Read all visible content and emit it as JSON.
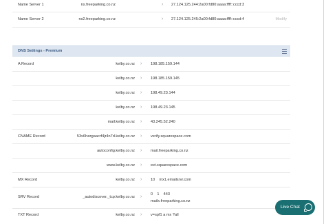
{
  "name_servers": [
    {
      "label": "Name Server 1",
      "host": "ns.freeparking.co.nz",
      "value": "27.124.125.244:2a00:fd80:aaaa:ffff::cccd:3",
      "action": ""
    },
    {
      "label": "Name Server 2",
      "host": "ns2.freeparking.co.nz",
      "value": "27.124.125.245:2a00:fd80:aaaa:ffff::cccd:4",
      "action": "Modify"
    }
  ],
  "dns_section": {
    "title": "DNS Settings - Premium",
    "menu_icon": "hamburger-menu-icon"
  },
  "records": [
    {
      "label": "A Record",
      "host": "kelby.co.nz",
      "value": "198.185.159.144",
      "value2": ""
    },
    {
      "label": "",
      "host": "kelby.co.nz",
      "value": "198.185.159.145",
      "value2": ""
    },
    {
      "label": "",
      "host": "kelby.co.nz",
      "value": "198.49.23.144",
      "value2": ""
    },
    {
      "label": "",
      "host": "kelby.co.nz",
      "value": "198.49.23.145",
      "value2": ""
    },
    {
      "label": "",
      "host": "mail.kelby.co.nz",
      "value": "43.245.52.240",
      "value2": ""
    },
    {
      "label": "CNAME Record",
      "host": "53x6hzzgaacrf4jr4n7d.kelby.co.nz",
      "value": "verify.squarespace.com",
      "value2": ""
    },
    {
      "label": "",
      "host": "autoconfig.kelby.co.nz",
      "value": "mail.freeparking.co.nz",
      "value2": ""
    },
    {
      "label": "",
      "host": "www.kelby.co.nz",
      "value": "ext.squarespace.com",
      "value2": ""
    },
    {
      "label": "MX Record",
      "host": "kelby.co.nz",
      "value": "10    mx1.emailsrvr.com",
      "value2": ""
    },
    {
      "label": "SRV Record",
      "host": "_autodiscover._tcp.kelby.co.nz",
      "value": "0    1    443",
      "value2": "mailx.freeparking.co.nz"
    },
    {
      "label": "TXT Record",
      "host": "kelby.co.nz",
      "value": "v=spf1 a mx ?all",
      "value2": ""
    }
  ],
  "chevron_icon": "chevron-right-icon",
  "live_chat": {
    "label": "Live Chat",
    "icon": "chat-bubble-icon",
    "color": "#1a6f72"
  }
}
